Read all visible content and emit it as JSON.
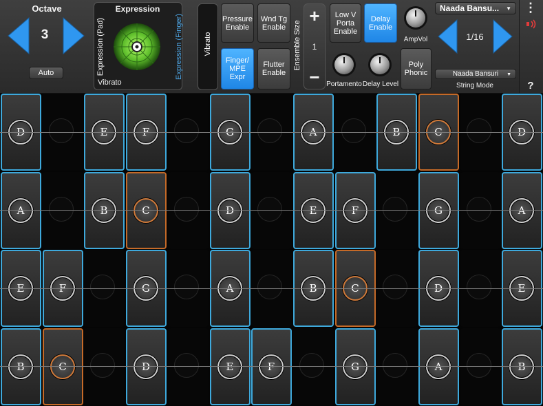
{
  "octave": {
    "label": "Octave",
    "value": "3",
    "auto_label": "Auto"
  },
  "expression": {
    "title": "Expression",
    "left_axis": "Expression (Pad)",
    "right_axis": "Expression (Finger)",
    "bottom": "Vibrato"
  },
  "vibrato_label": "Vibrato",
  "buttons": {
    "pressure": "Pressure\nEnable",
    "wnd_tg": "Wnd Tg\nEnable",
    "finger_mpe": "Finger/\nMPE\nExpr",
    "flutter": "Flutter\nEnable",
    "low_v": "Low V\nPorta\nEnable",
    "delay_enable": "Delay\nEnable",
    "poly": "Poly\nPhonic"
  },
  "ensemble": {
    "label": "Ensemble Size",
    "value": "1",
    "plus": "+",
    "minus": "−"
  },
  "knobs": {
    "ampvol": "AmpVol",
    "portamento": "Portamento",
    "delay_level": "Delay Level"
  },
  "instrument": {
    "name": "Naada Bansu...",
    "string_mode_value": "Naada Bansuri",
    "string_mode_label": "String Mode",
    "page": "1/16"
  },
  "side": {
    "menu": "⋮",
    "help": "?"
  },
  "colors": {
    "accent": "#2f97f0",
    "note_border": "#3ea9dc",
    "root_border": "#c56a28",
    "pad_green": "#7de04a"
  },
  "pad_rows": [
    [
      "D",
      "",
      "E",
      "F",
      "",
      "G",
      "",
      "A",
      "",
      "B",
      "C",
      "",
      "D"
    ],
    [
      "A",
      "",
      "B",
      "C",
      "",
      "D",
      "",
      "E",
      "F",
      "",
      "G",
      "",
      "A"
    ],
    [
      "E",
      "F",
      "",
      "G",
      "",
      "A",
      "",
      "B",
      "C",
      "",
      "D",
      "",
      "E"
    ],
    [
      "B",
      "C",
      "",
      "D",
      "",
      "E",
      "F",
      "",
      "G",
      "",
      "A",
      "",
      "B"
    ]
  ],
  "root_note": "C"
}
